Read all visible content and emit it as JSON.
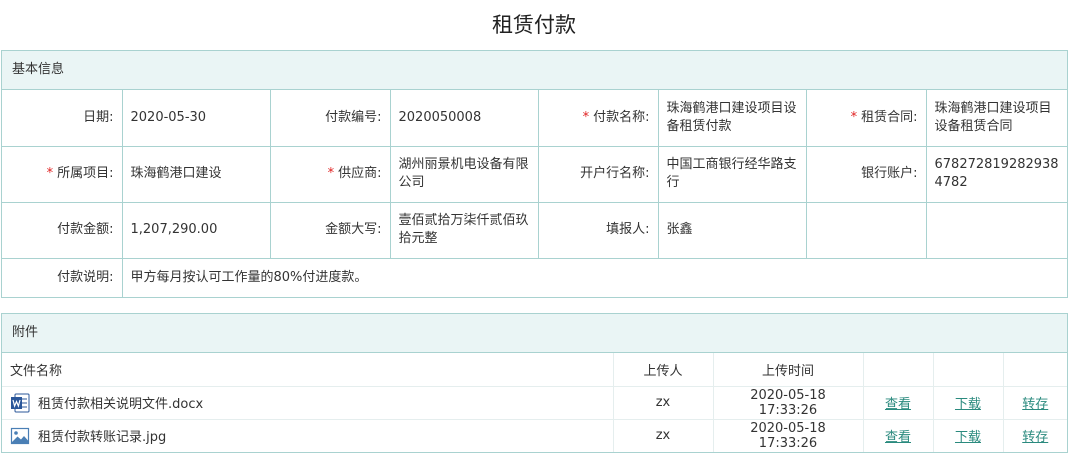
{
  "page": {
    "title": "租赁付款"
  },
  "basic": {
    "header": "基本信息",
    "date_label": "日期:",
    "date": "2020-05-30",
    "payno_label": "付款编号:",
    "payno": "2020050008",
    "payname_label": "付款名称:",
    "payname": "珠海鹤港口建设项目设备租赁付款",
    "contract_label": "租赁合同:",
    "contract": "珠海鹤港口建设项目设备租赁合同",
    "project_label": "所属项目:",
    "project": "珠海鹤港口建设",
    "supplier_label": "供应商:",
    "supplier": "湖州丽景机电设备有限公司",
    "bank_label": "开户行名称:",
    "bank": "中国工商银行经华路支行",
    "account_label": "银行账户:",
    "account": "6782728192829384782",
    "amount_label": "付款金额:",
    "amount": "1,207,290.00",
    "amount_cn_label": "金额大写:",
    "amount_cn": "壹佰贰拾万柒仟贰佰玖拾元整",
    "reporter_label": "填报人:",
    "reporter": "张鑫",
    "note_label": "付款说明:",
    "note": "甲方每月按认可工作量的80%付进度款。"
  },
  "attachments": {
    "header": "附件",
    "columns": {
      "name": "文件名称",
      "uploader": "上传人",
      "time": "上传时间"
    },
    "files": [
      {
        "name": "租赁付款相关说明文件.docx",
        "icon": "word-doc-icon",
        "uploader": "zx",
        "time": "2020-05-18 17:33:26",
        "view": "查看",
        "download": "下载",
        "save": "转存"
      },
      {
        "name": "租赁付款转账记录.jpg",
        "icon": "image-file-icon",
        "uploader": "zx",
        "time": "2020-05-18 17:33:26",
        "view": "查看",
        "download": "下载",
        "save": "转存"
      }
    ]
  },
  "colors": {
    "border": "#a9d2d0",
    "header_bg": "#eaf5f5",
    "link": "#2a8a7e",
    "required": "#e02020"
  }
}
